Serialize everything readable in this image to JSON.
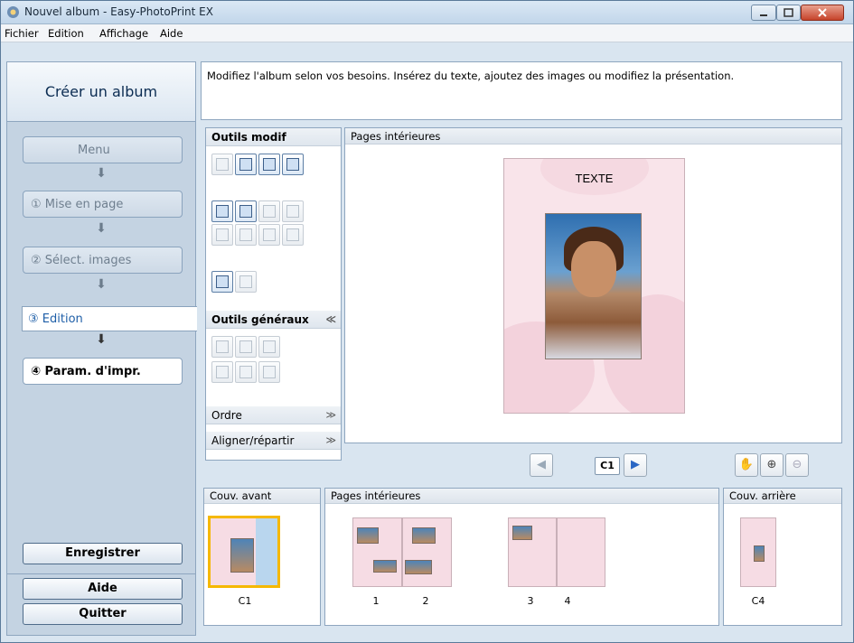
{
  "window": {
    "title": "Nouvel album - Easy-PhotoPrint EX"
  },
  "menu": [
    "Fichier",
    "Edition",
    "Affichage",
    "Aide"
  ],
  "sidebar": {
    "heading": "Créer un album",
    "steps": [
      "Menu",
      "①  Mise en page",
      "②  Sélect. images",
      "③       Edition",
      "④  Param. d'impr."
    ],
    "buttons": [
      "Enregistrer",
      "Aide",
      "Quitter"
    ]
  },
  "guide_text": "Modifiez l'album selon vos besoins. Insérez du texte, ajoutez des images ou modifiez la présentation.",
  "tools": {
    "edit_tools_title": "Outils modif",
    "general_tools_title": "Outils généraux",
    "order_label": "Ordre",
    "align_label": "Aligner/répartir"
  },
  "edit_area": {
    "title": "Pages intérieures",
    "page_text": "TEXTE",
    "current_page": "C1"
  },
  "strips": {
    "front_title": "Couv. avant",
    "inner_title": "Pages intérieures",
    "back_title": "Couv. arrière",
    "front_label": "C1",
    "inner_labels": [
      "1",
      "2",
      "3",
      "4"
    ],
    "back_label": "C4"
  },
  "colors": {
    "accent": "#1f5fa8",
    "selection": "#f5b800",
    "page": "#f9e4ea"
  }
}
